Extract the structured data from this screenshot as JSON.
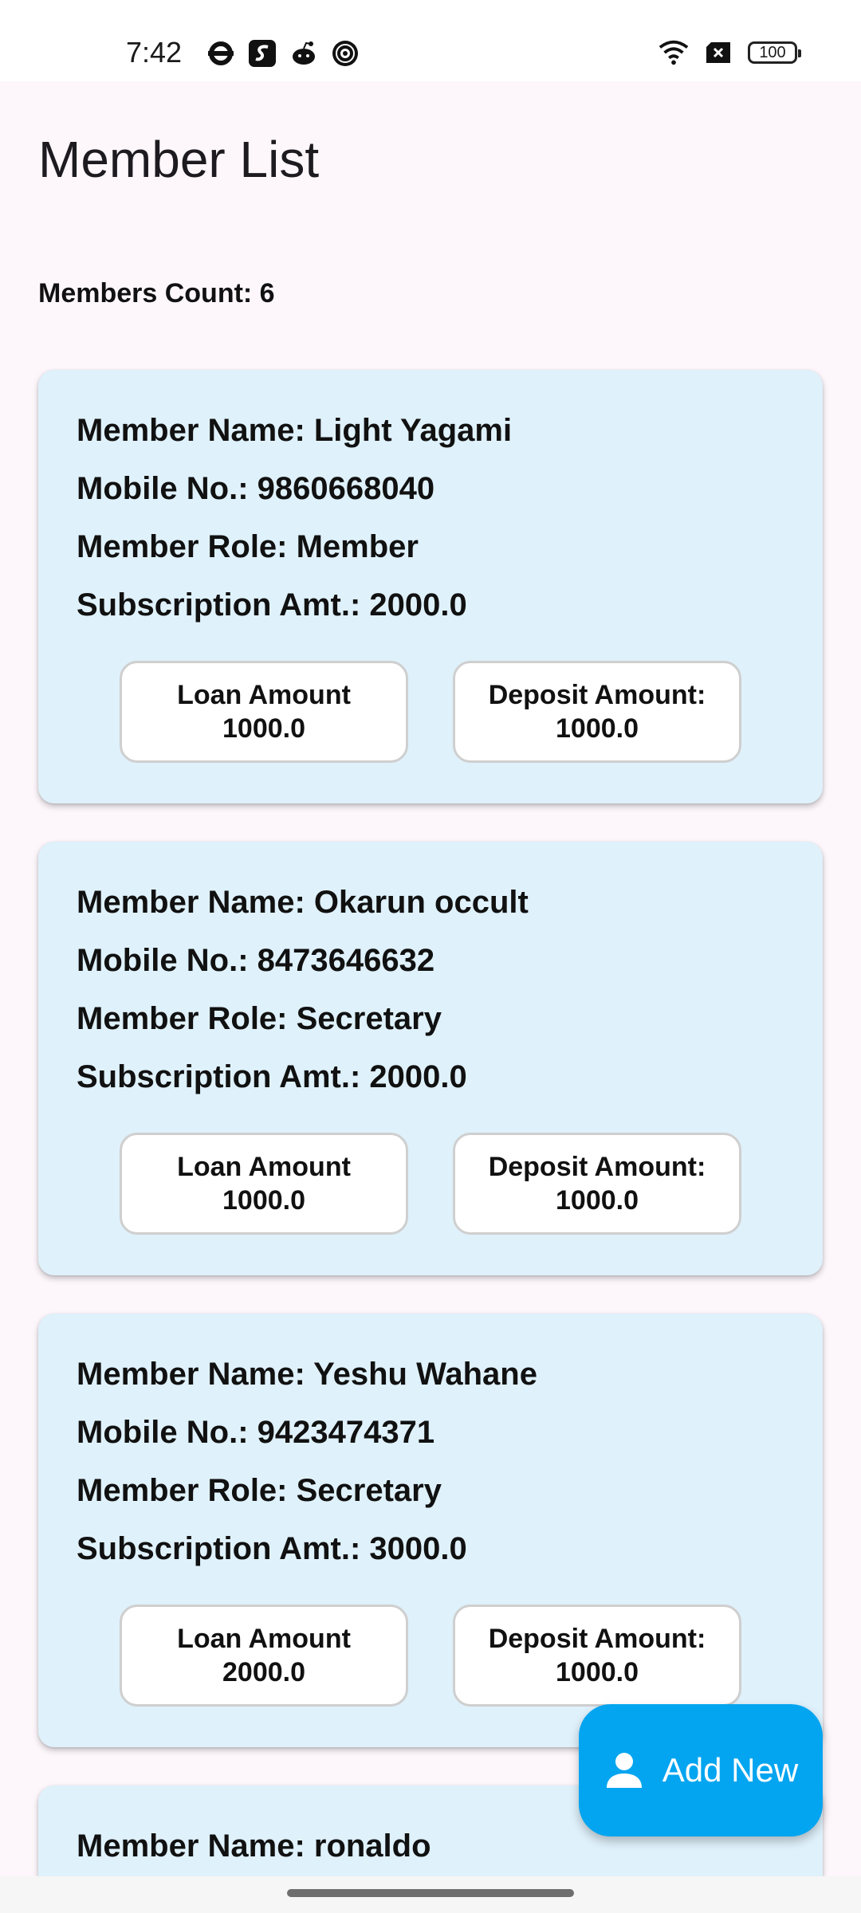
{
  "status_bar": {
    "time": "7:42",
    "battery": "100",
    "left_icons": [
      "underground-icon",
      "app-s-icon",
      "reddit-icon",
      "club-badge-icon"
    ],
    "right_icons": [
      "wifi-icon",
      "no-sim-icon",
      "battery-icon"
    ]
  },
  "page": {
    "title": "Member List",
    "members_count_label": "Members Count: 6"
  },
  "members": [
    {
      "name": "Member Name: Light Yagami",
      "mobile": "Mobile No.: 9860668040",
      "role": "Member Role: Member",
      "subscription": "Subscription Amt.: 2000.0",
      "loan_label": "Loan Amount",
      "loan_value": "1000.0",
      "deposit_label": "Deposit Amount:",
      "deposit_value": "1000.0"
    },
    {
      "name": "Member Name: Okarun occult",
      "mobile": "Mobile No.: 8473646632",
      "role": "Member Role: Secretary",
      "subscription": "Subscription Amt.: 2000.0",
      "loan_label": "Loan Amount",
      "loan_value": "1000.0",
      "deposit_label": "Deposit Amount:",
      "deposit_value": "1000.0"
    },
    {
      "name": "Member Name: Yeshu Wahane",
      "mobile": "Mobile No.: 9423474371",
      "role": "Member Role: Secretary",
      "subscription": "Subscription Amt.: 3000.0",
      "loan_label": "Loan Amount",
      "loan_value": "2000.0",
      "deposit_label": "Deposit Amount:",
      "deposit_value": "1000.0"
    },
    {
      "name": "Member Name: ronaldo"
    }
  ],
  "fab": {
    "label": "Add New",
    "icon": "person-icon"
  },
  "colors": {
    "background": "#fdf7fc",
    "card": "#dff1fb",
    "fab": "#04a5f0"
  }
}
